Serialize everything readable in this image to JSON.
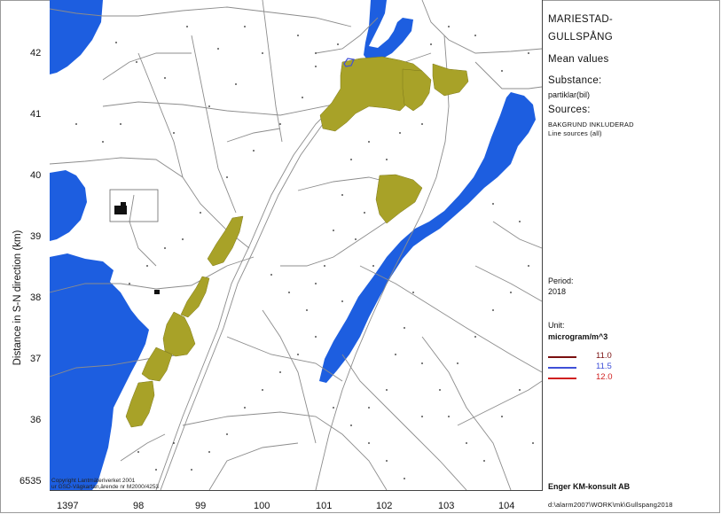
{
  "header": {
    "title_line1": "MARIESTAD-",
    "title_line2": "GULLSPÅNG",
    "subtitle": "Mean values"
  },
  "panel": {
    "substance_label": "Substance:",
    "substance_value": "partiklar(bil)",
    "sources_label": "Sources:",
    "source_1": "BAKGRUND INKLUDERAD",
    "source_2": "Line sources (all)",
    "period_label": "Period:",
    "period_value": "2018",
    "unit_label": "Unit:",
    "unit_value": "microgram/m^3",
    "legend": [
      {
        "value": "11.0",
        "color": "#7a1010"
      },
      {
        "value": "11.5",
        "color": "#3f50d8"
      },
      {
        "value": "12.0",
        "color": "#d02020"
      }
    ],
    "company": "Enger KM-konsult AB",
    "file_path": "d:\\alarm2007\\WORK\\mk\\Gullspang2018"
  },
  "axes": {
    "ylabel": "Distance in S-N direction (km)",
    "yticks": [
      "42",
      "41",
      "40",
      "39",
      "38",
      "37",
      "36"
    ],
    "y_origin": "6535",
    "xticks": [
      "1397",
      "98",
      "99",
      "100",
      "101",
      "102",
      "103",
      "104"
    ]
  },
  "copyright": {
    "line1": "Copyright Lantmäteriverket 2001",
    "line2": "ur GSD-Vägkartan,ärende nr M2000/4253"
  },
  "colors": {
    "water": "#1d5ee0",
    "urban": "#a8a228",
    "roads": "#8c8c8c",
    "contour_11_5": "#3f50d8"
  }
}
